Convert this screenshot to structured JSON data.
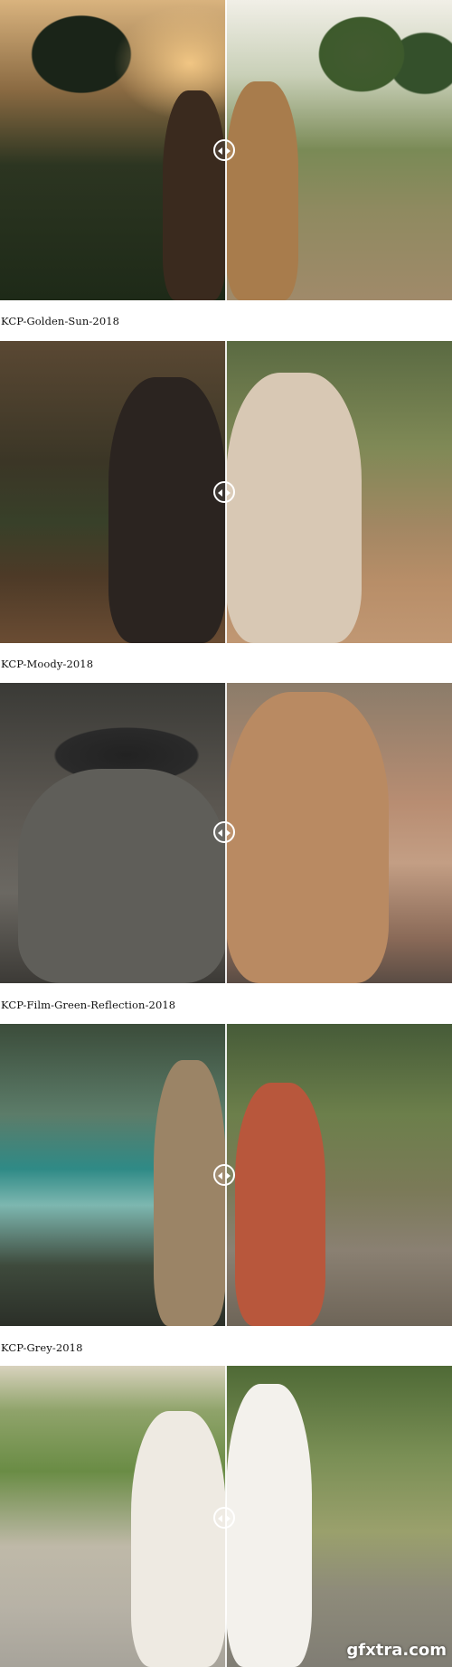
{
  "panels": [
    {
      "label": "KCP-Golden-Sun-2018"
    },
    {
      "label": "KCP-Moody-2018"
    },
    {
      "label": "KCP-Film-Green-Reflection-2018"
    },
    {
      "label": "KCP-Grey-2018"
    },
    {
      "label": ""
    }
  ],
  "watermark": "gfxtra.com"
}
